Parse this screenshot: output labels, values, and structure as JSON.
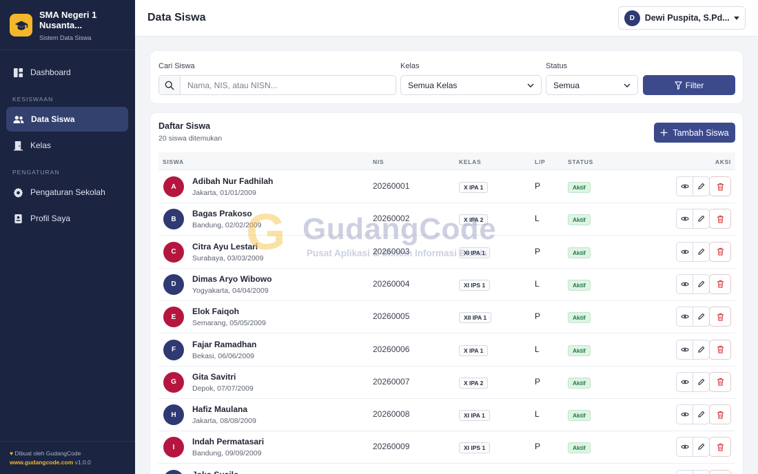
{
  "brand": {
    "name": "SMA Negeri 1 Nusanta...",
    "subtitle": "Sistem Data Siswa"
  },
  "sidebar": {
    "items": [
      {
        "label": "Dashboard",
        "icon": "dashboard-icon"
      },
      {
        "label": "Data Siswa",
        "icon": "users-icon",
        "active": true
      },
      {
        "label": "Kelas",
        "icon": "door-icon"
      },
      {
        "label": "Pengaturan Sekolah",
        "icon": "gear-icon"
      },
      {
        "label": "Profil Saya",
        "icon": "id-card-icon"
      }
    ],
    "sections": [
      "KESISWAAN",
      "PENGATURAN"
    ],
    "footer": {
      "credit": "Dibuat oleh GudangCode",
      "url": "www.gudangcode.com",
      "version": "v1.0.0"
    }
  },
  "header": {
    "title": "Data Siswa",
    "user": {
      "initial": "D",
      "name": "Dewi Puspita, S.Pd..."
    }
  },
  "filters": {
    "search_label": "Cari Siswa",
    "search_placeholder": "Nama, NIS, atau NISN...",
    "search_value": "",
    "kelas_label": "Kelas",
    "kelas_value": "Semua Kelas",
    "status_label": "Status",
    "status_value": "Semua",
    "filter_button": "Filter"
  },
  "list": {
    "title": "Daftar Siswa",
    "count": "20 siswa ditemukan",
    "add_button": "Tambah Siswa",
    "columns": [
      "SISWA",
      "NIS",
      "KELAS",
      "L/P",
      "STATUS",
      "AKSI"
    ],
    "rows": [
      {
        "initial": "A",
        "name": "Adibah Nur Fadhilah",
        "birth": "Jakarta, 01/01/2009",
        "nis": "20260001",
        "kelas": "X IPA 1",
        "lp": "P",
        "status": "Aktif",
        "avatar_color": "#b5163f"
      },
      {
        "initial": "B",
        "name": "Bagas Prakoso",
        "birth": "Bandung, 02/02/2009",
        "nis": "20260002",
        "kelas": "X IPA 2",
        "lp": "L",
        "status": "Aktif",
        "avatar_color": "#2f3a73"
      },
      {
        "initial": "C",
        "name": "Citra Ayu Lestari",
        "birth": "Surabaya, 03/03/2009",
        "nis": "20260003",
        "kelas": "XI IPA 1",
        "lp": "P",
        "status": "Aktif",
        "avatar_color": "#b5163f"
      },
      {
        "initial": "D",
        "name": "Dimas Aryo Wibowo",
        "birth": "Yogyakarta, 04/04/2009",
        "nis": "20260004",
        "kelas": "XI IPS 1",
        "lp": "L",
        "status": "Aktif",
        "avatar_color": "#2f3a73"
      },
      {
        "initial": "E",
        "name": "Elok Faiqoh",
        "birth": "Semarang, 05/05/2009",
        "nis": "20260005",
        "kelas": "XII IPA 1",
        "lp": "P",
        "status": "Aktif",
        "avatar_color": "#b5163f"
      },
      {
        "initial": "F",
        "name": "Fajar Ramadhan",
        "birth": "Bekasi, 06/06/2009",
        "nis": "20260006",
        "kelas": "X IPA 1",
        "lp": "L",
        "status": "Aktif",
        "avatar_color": "#2f3a73"
      },
      {
        "initial": "G",
        "name": "Gita Savitri",
        "birth": "Depok, 07/07/2009",
        "nis": "20260007",
        "kelas": "X IPA 2",
        "lp": "P",
        "status": "Aktif",
        "avatar_color": "#b5163f"
      },
      {
        "initial": "H",
        "name": "Hafiz Maulana",
        "birth": "Jakarta, 08/08/2009",
        "nis": "20260008",
        "kelas": "XI IPA 1",
        "lp": "L",
        "status": "Aktif",
        "avatar_color": "#2f3a73"
      },
      {
        "initial": "I",
        "name": "Indah Permatasari",
        "birth": "Bandung, 09/09/2009",
        "nis": "20260009",
        "kelas": "XI IPS 1",
        "lp": "P",
        "status": "Aktif",
        "avatar_color": "#b5163f"
      },
      {
        "initial": "J",
        "name": "Joko Susilo",
        "birth": "",
        "nis": "",
        "kelas": "",
        "lp": "",
        "status": "",
        "avatar_color": "#2f3a73"
      }
    ]
  },
  "watermark": {
    "letter": "G",
    "title": "GudangCode",
    "subtitle": "Pusat Aplikasi & Sistem Informasi Bisnis"
  },
  "colors": {
    "sidebar_bg": "#1b2440",
    "accent": "#3c4a8c",
    "brand_yellow": "#f4b62a",
    "status_green": "#1e7a3e",
    "danger": "#d9363e"
  }
}
